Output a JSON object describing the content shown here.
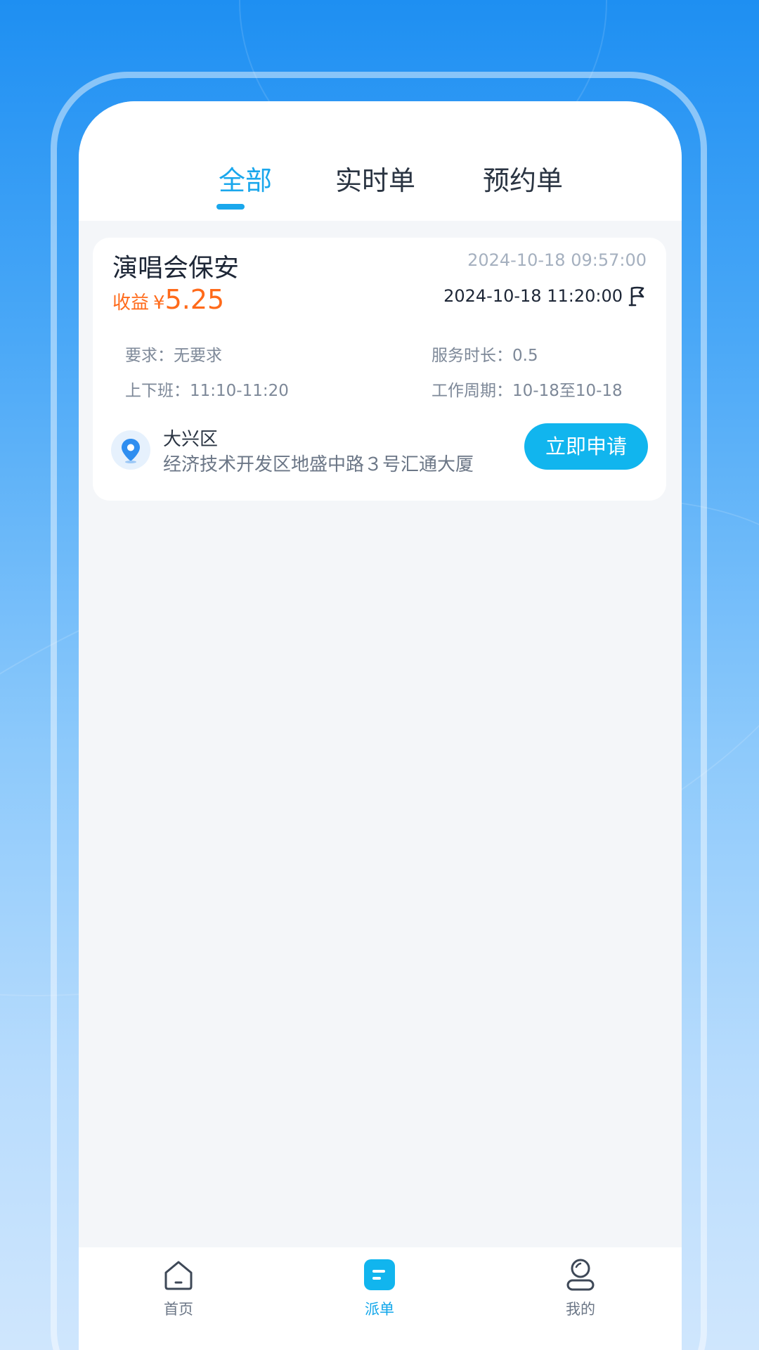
{
  "tabs": [
    {
      "label": "全部",
      "active": true
    },
    {
      "label": "实时单",
      "active": false
    },
    {
      "label": "预约单",
      "active": false
    }
  ],
  "order": {
    "title": "演唱会保安",
    "posted_time": "2024-10-18 09:57:00",
    "income_label": "收益",
    "currency": "¥",
    "amount": "5.25",
    "end_time": "2024-10-18 11:20:00",
    "requirement_label": "要求：",
    "requirement_value": "无要求",
    "duration_label": "服务时长：",
    "duration_value": "0.5",
    "shift_label": "上下班：",
    "shift_value": "11:10-11:20",
    "cycle_label": "工作周期：",
    "cycle_value": "10-18至10-18",
    "district": "大兴区",
    "address": "经济技术开发区地盛中路３号汇通大厦",
    "apply_label": "立即申请"
  },
  "nav": [
    {
      "label": "首页",
      "icon": "home-icon",
      "active": false
    },
    {
      "label": "派单",
      "icon": "dispatch-icon",
      "active": true
    },
    {
      "label": "我的",
      "icon": "profile-icon",
      "active": false
    }
  ],
  "colors": {
    "accent": "#1aa7ec",
    "apply_button": "#11b5ee",
    "income": "#ff6a1a",
    "background_top": "#1e8ff2",
    "background_bottom": "#cfe6fd"
  }
}
